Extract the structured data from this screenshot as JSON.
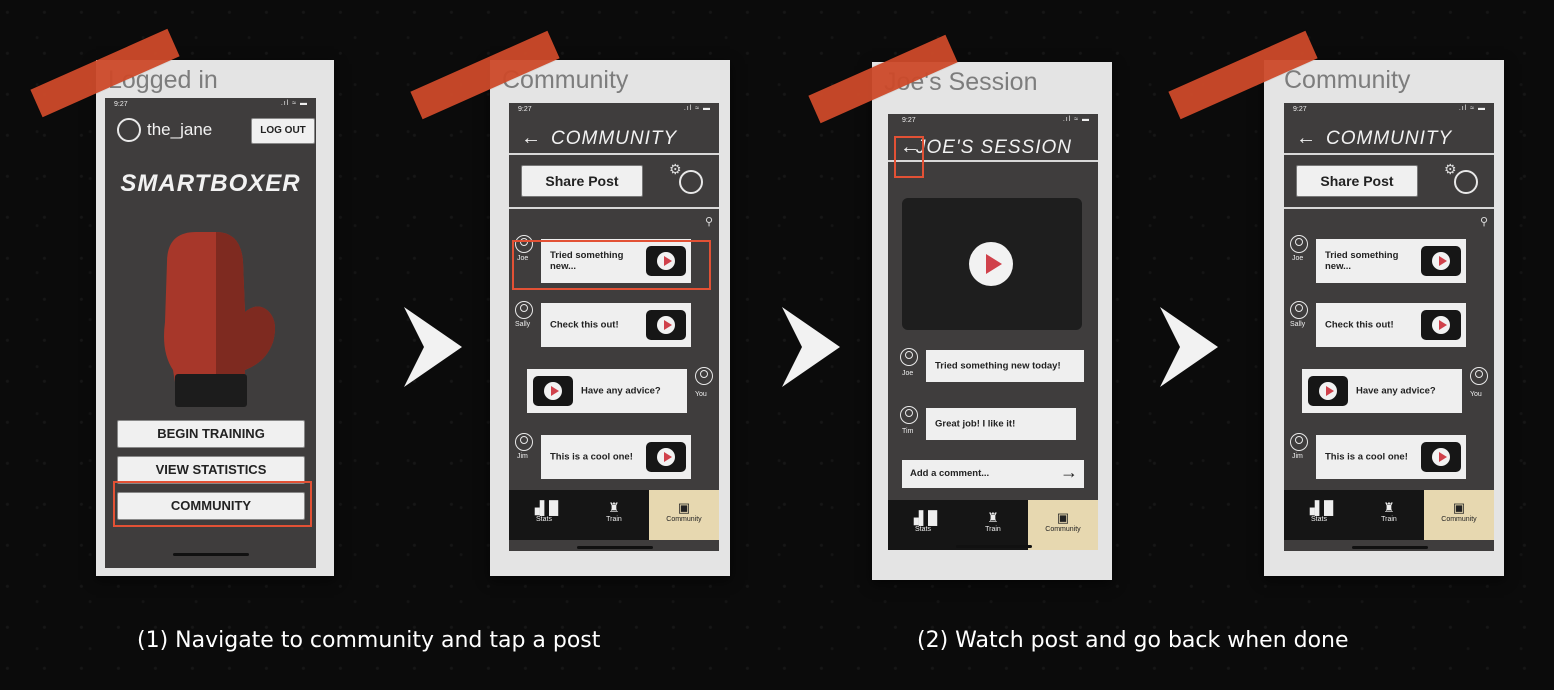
{
  "screen1": {
    "card_title": "Logged in",
    "time": "9:27",
    "signal": ".ıl ≈ ▬",
    "username": "the_jane",
    "logout_label": "LOG OUT",
    "brand": "SMARTBOXER",
    "buttons": [
      "BEGIN TRAINING",
      "VIEW STATISTICS",
      "COMMUNITY"
    ]
  },
  "community": {
    "card_title": "Community",
    "time": "9:27",
    "signal": ".ıl ≈ ▬",
    "header_title": "COMMUNITY",
    "back_arrow": "←",
    "share_label": "Share Post",
    "search_glyph": "⚲",
    "posts": [
      {
        "user": "Joe",
        "text": "Tried something new...",
        "side": "left"
      },
      {
        "user": "Sally",
        "text": "Check this out!",
        "side": "left"
      },
      {
        "user": "You",
        "text": "Have any advice?",
        "side": "right"
      },
      {
        "user": "Jim",
        "text": "This is a cool one!",
        "side": "left"
      }
    ],
    "tabs": [
      "Stats",
      "Train",
      "Community"
    ]
  },
  "session": {
    "card_title": "Joe's Session",
    "time": "9:27",
    "signal": ".ıl ≈ ▬",
    "header_title": "JOE'S SESSION",
    "back_arrow": "←",
    "comments": [
      {
        "user": "Joe",
        "text": "Tried something new today!"
      },
      {
        "user": "Tim",
        "text": "Great job! I like it!"
      }
    ],
    "comment_placeholder": "Add a comment...",
    "send_arrow": "→",
    "tabs": [
      "Stats",
      "Train",
      "Community"
    ]
  },
  "captions": {
    "step1": "(1) Navigate to community and tap a post",
    "step2": "(2) Watch post and go back when done"
  },
  "colors": {
    "tape": "#cd4a2a",
    "highlight": "#e25135",
    "phone_bg": "#3f3d3d",
    "active_tab": "#e7d8b0"
  }
}
